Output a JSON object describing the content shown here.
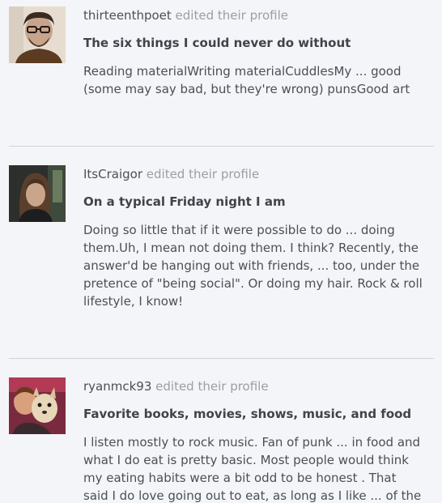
{
  "feed": {
    "items": [
      {
        "username": "thirteenthpoet",
        "action": "edited their profile",
        "question": "The six things I could never do without",
        "answer": "Reading materialWriting materialCuddlesMy ... good (some may say bad, but they're wrong) punsGood art"
      },
      {
        "username": "ItsCraigor",
        "action": "edited their profile",
        "question": "On a typical Friday night I am",
        "answer": "Doing so little that if it were possible to do ... doing them.Uh, I mean not doing them. I think? Recently, the answer'd be hanging out with friends, ... too, under the pretence of \"being social\". Or doing my hair. Rock & roll lifestyle, I know!"
      },
      {
        "username": "ryanmck93",
        "action": "edited their profile",
        "question": "Favorite books, movies, shows, music, and food",
        "answer": "I listen mostly to rock music. Fan of punk ... in food and what I do eat is pretty basic. Most people would think my eating habits were a bit odd to be honest . That said I do love going out to eat, as long as I like ... of the Old Republic"
      }
    ]
  }
}
